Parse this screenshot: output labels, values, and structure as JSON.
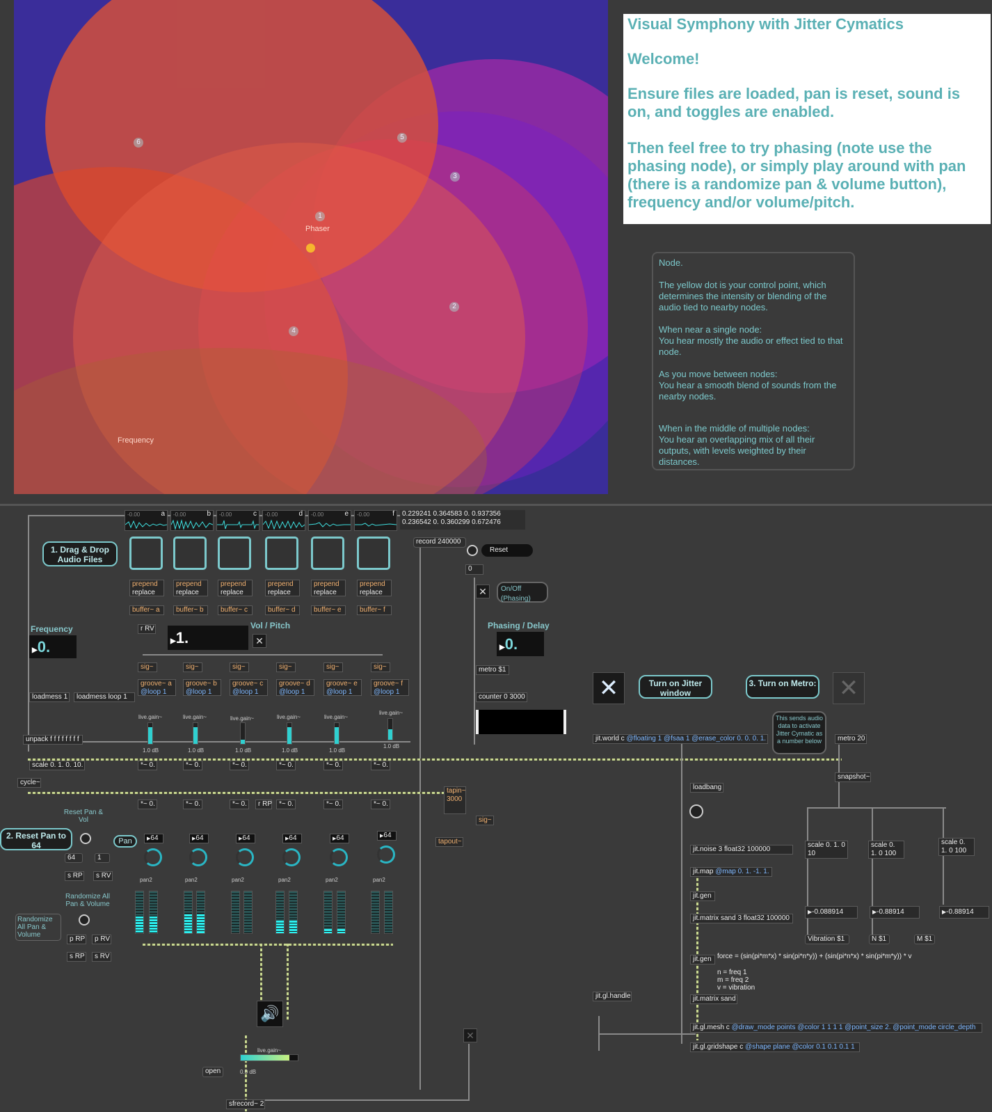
{
  "canvas": {
    "node_labels": [
      "1",
      "2",
      "3",
      "4",
      "5",
      "6"
    ],
    "text_phaser": "Phaser",
    "text_frequency": "Frequency"
  },
  "info": {
    "title": "Visual Symphony with Jitter Cymatics",
    "welcome": "Welcome!",
    "ensure": "Ensure files are loaded, pan is reset, sound is on, and toggles are enabled.",
    "then": "Then feel free to try phasing (note use the phasing node), or simply play around with pan (there is a randomize pan & volume button), frequency and/or volume/pitch."
  },
  "node_note": {
    "title": "Node.",
    "p1": "The yellow dot is your control point, which determines the intensity or blending of the audio tied to nearby nodes.",
    "p2": "When near a single node:\nYou hear mostly the audio or effect tied to that node.",
    "p3": "As you move between nodes:\nYou hear a smooth blend of sounds from the nearby nodes.",
    "p4": "When in the middle of multiple nodes:\nYou hear an overlapping mix of all their outputs, with levels weighted by their distances."
  },
  "patch": {
    "wave_letters": [
      "a",
      "b",
      "c",
      "d",
      "e",
      "f"
    ],
    "wave_db": "-0.00",
    "coords_line1": "0.229241 0.364583 0. 0.937356",
    "coords_line2": "0.236542 0. 0.360299 0.672476",
    "drag_drop": "1. Drag & Drop Audio Files",
    "prepend": "prepend",
    "replace": "replace",
    "buffers": [
      "buffer~ a",
      "buffer~ b",
      "buffer~ c",
      "buffer~ d",
      "buffer~ e",
      "buffer~ f"
    ],
    "record": "record 240000",
    "reset": "Reset",
    "zero": "0",
    "onoff": "On/Off (Phasing)",
    "rRV": "r RV",
    "frequency_label": "Frequency",
    "frequency_value": "0.",
    "volpitch_label": "Vol / Pitch",
    "volpitch_value": "1.",
    "phasing_label": "Phasing / Delay",
    "phasing_value": "0.",
    "sig": "sig~",
    "grooves": [
      "groove~ a",
      "groove~ b",
      "groove~ c",
      "groove~ d",
      "groove~ e",
      "groove~ f"
    ],
    "loop": "@loop 1",
    "loadmess1": "loadmess 1",
    "loadmess_loop": "loadmess loop 1",
    "metro1": "metro $1",
    "counter": "counter 0 3000",
    "jitter_window": "Turn on Jitter window",
    "turn_metro": "3. Turn on Metro:",
    "sends_note": "This sends audio data to activate Jitter Cymatic as a number below",
    "livegain": "live.gain~",
    "db": "1.0 dB",
    "unpack": "unpack f f f f f f f f",
    "scale_main": "scale 0. 1. 0. 10.",
    "times0": "*~ 0.",
    "cycle": "cycle~",
    "tapin": "tapin~ 3000",
    "tapout": "tapout~",
    "sig2": "sig~",
    "jitworld": "jit.world c",
    "jitworld_attr": "@floating 1 @fsaa 1 @erase_color 0. 0. 0. 1.",
    "metro20": "metro 20",
    "snapshot": "snapshot~",
    "loadbang": "loadbang",
    "jitnoise": "jit.noise 3 float32 100000",
    "jitmap": "jit.map",
    "jitmap_attr": "@map 0. 1. -1. 1.",
    "jitgen": "jit.gen",
    "jitmatrix1": "jit.matrix sand 3 float32 100000",
    "scale_a": "scale 0. 1. 0 10",
    "scale_b": "scale 0. 1. 0 100",
    "scale_c": "scale 0. 1. 0 100",
    "vib_a": "-0.088914",
    "vib_b": "-0.88914",
    "vib_c": "-0.88914",
    "msg_vib": "Vibration $1",
    "msg_n": "N $1",
    "msg_m": "M $1",
    "force": "force = (sin(pi*m*x) * sin(pi*n*y)) + (sin(pi*n*x) * sin(pi*m*y)) * v",
    "legend_n": "n = freq 1",
    "legend_m": "m = freq 2",
    "legend_v": "v = vibration",
    "jitmatrix2": "jit.matrix sand",
    "jithandle": "jit.gl.handle",
    "mesh": "jit.gl.mesh c",
    "mesh_attr": "@draw_mode points @color 1 1 1 1 @point_size 2. @point_mode circle_depth",
    "gridshape": "jit.gl.gridshape c",
    "gridshape_attr": "@shape plane @color 0.1 0.1 0.1 1",
    "reset_pan_vol": "Reset Pan & Vol",
    "reset_pan64": "2. Reset Pan to 64",
    "v64": "64",
    "v1": "1",
    "sRP": "s RP",
    "sRV": "s RV",
    "pan": "Pan",
    "pan_value": "64",
    "pan2": "pan2",
    "rRP": "r RP",
    "randomize_all": "Randomize All Pan & Volume",
    "randomize_all2": "Randomize All Pan & Volume",
    "pRP": "p RP",
    "pRV": "p RV",
    "open": "open",
    "master_db": "0.0 dB",
    "sfrecord": "sfrecord~ 2"
  },
  "colors": {
    "accent": "#7cc9cc",
    "info_text": "#5ab0b4",
    "meter": "#2fd0d0"
  }
}
